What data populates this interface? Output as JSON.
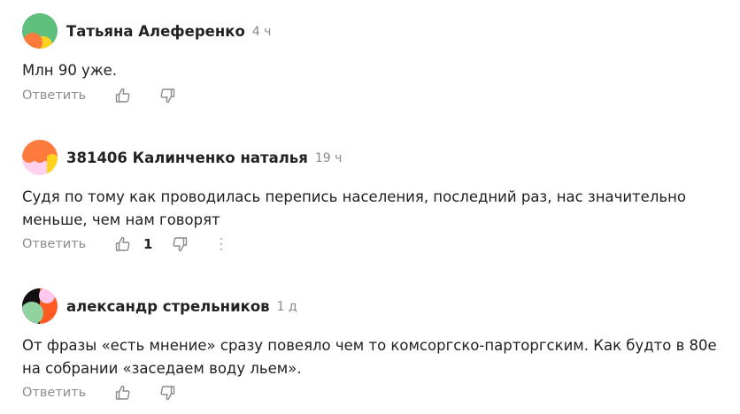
{
  "comments": [
    {
      "author": "Татьяна Алеференко",
      "time": "4 ч",
      "text": "Млн 90 уже.",
      "reply_label": "Ответить",
      "likes": ""
    },
    {
      "author": "381406 Калинченко наталья",
      "time": "19 ч",
      "text": "Судя по тому как проводилась перепись населения, последний раз, нас значительно меньше, чем нам говорят",
      "reply_label": "Ответить",
      "likes": "1"
    },
    {
      "author": "александр стрельников",
      "time": "1 д",
      "text": "От фразы «есть мнение» сразу повеяло чем то комсоргско-парторгским. Как будто в 80е на собрании «заседаем воду льем».",
      "reply_label": "Ответить",
      "likes": ""
    }
  ],
  "icons": {
    "like": "thumbs-up-icon",
    "dislike": "thumbs-down-icon",
    "more": "more-vertical-icon"
  },
  "colors": {
    "muted_text": "#8c8c8c",
    "icon_stroke": "#8a8a8a"
  }
}
